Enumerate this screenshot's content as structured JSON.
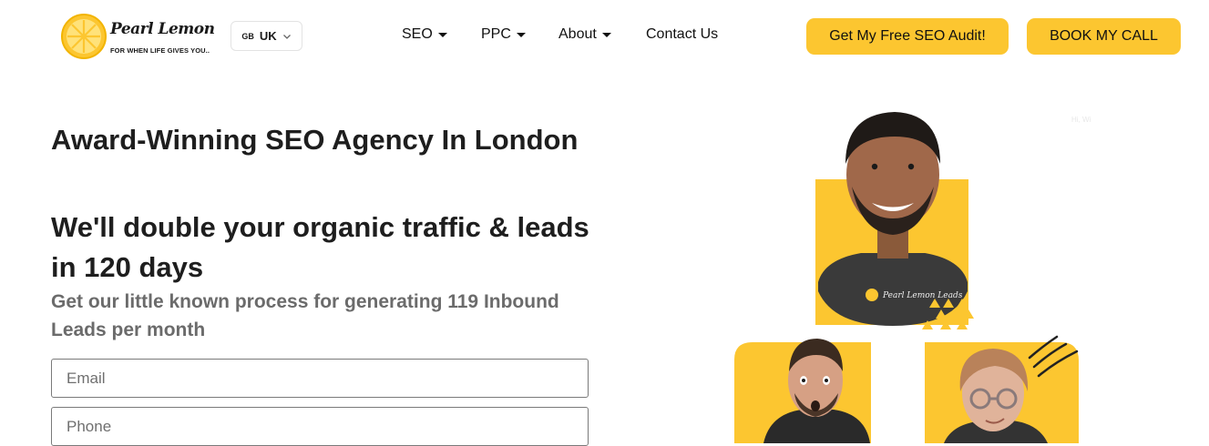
{
  "header": {
    "logo": {
      "name": "Pearl Lemon",
      "tagline": "FOR WHEN LIFE GIVES YOU.."
    },
    "country": {
      "flag": "GB",
      "code": "UK"
    },
    "nav": [
      {
        "label": "SEO",
        "has_dropdown": true
      },
      {
        "label": "PPC",
        "has_dropdown": true
      },
      {
        "label": "About",
        "has_dropdown": true
      },
      {
        "label": "Contact Us",
        "has_dropdown": false
      }
    ],
    "cta_primary": "Get My Free SEO Audit!",
    "cta_secondary": "BOOK MY CALL"
  },
  "hero": {
    "title": "Award-Winning SEO Agency In London",
    "subtitle": "We'll double your organic traffic & leads in 120 days",
    "description": "Get our little known process for generating 119 Inbound Leads per month",
    "form": {
      "email_placeholder": "Email",
      "phone_placeholder": "Phone"
    },
    "shirt_print": "Pearl Lemon Leads",
    "faint_text": "Hi, Wi"
  },
  "colors": {
    "brand_yellow": "#fcc630",
    "text_dark": "#1e1e1e",
    "text_gray": "#6b6b6b"
  }
}
